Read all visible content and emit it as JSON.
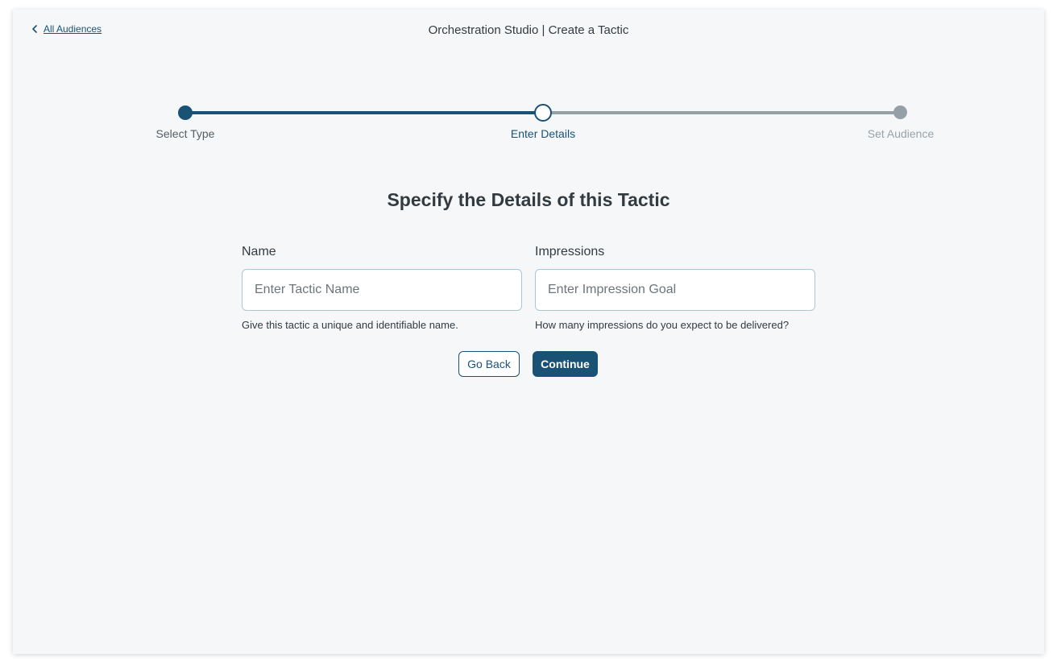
{
  "header": {
    "back_link_label": "All Audiences",
    "back_icon": "chevron-left-icon",
    "title": "Orchestration Studio | Create a Tactic"
  },
  "stepper": {
    "steps": [
      {
        "label": "Select Type",
        "state": "completed"
      },
      {
        "label": "Enter Details",
        "state": "current"
      },
      {
        "label": "Set Audience",
        "state": "upcoming"
      }
    ]
  },
  "main": {
    "title": "Specify the Details of this Tactic",
    "fields": {
      "name": {
        "label": "Name",
        "value": "",
        "placeholder": "Enter Tactic Name",
        "help": "Give this tactic a unique and identifiable name."
      },
      "impressions": {
        "label": "Impressions",
        "value": "",
        "placeholder": "Enter Impression Goal",
        "help": "How many impressions do you expect to be delivered?"
      }
    },
    "buttons": {
      "back_label": "Go Back",
      "continue_label": "Continue"
    }
  },
  "colors": {
    "primary": "#1a5276",
    "inactive": "#959fa6",
    "background": "#f5f7f9",
    "text": "#333b41"
  }
}
